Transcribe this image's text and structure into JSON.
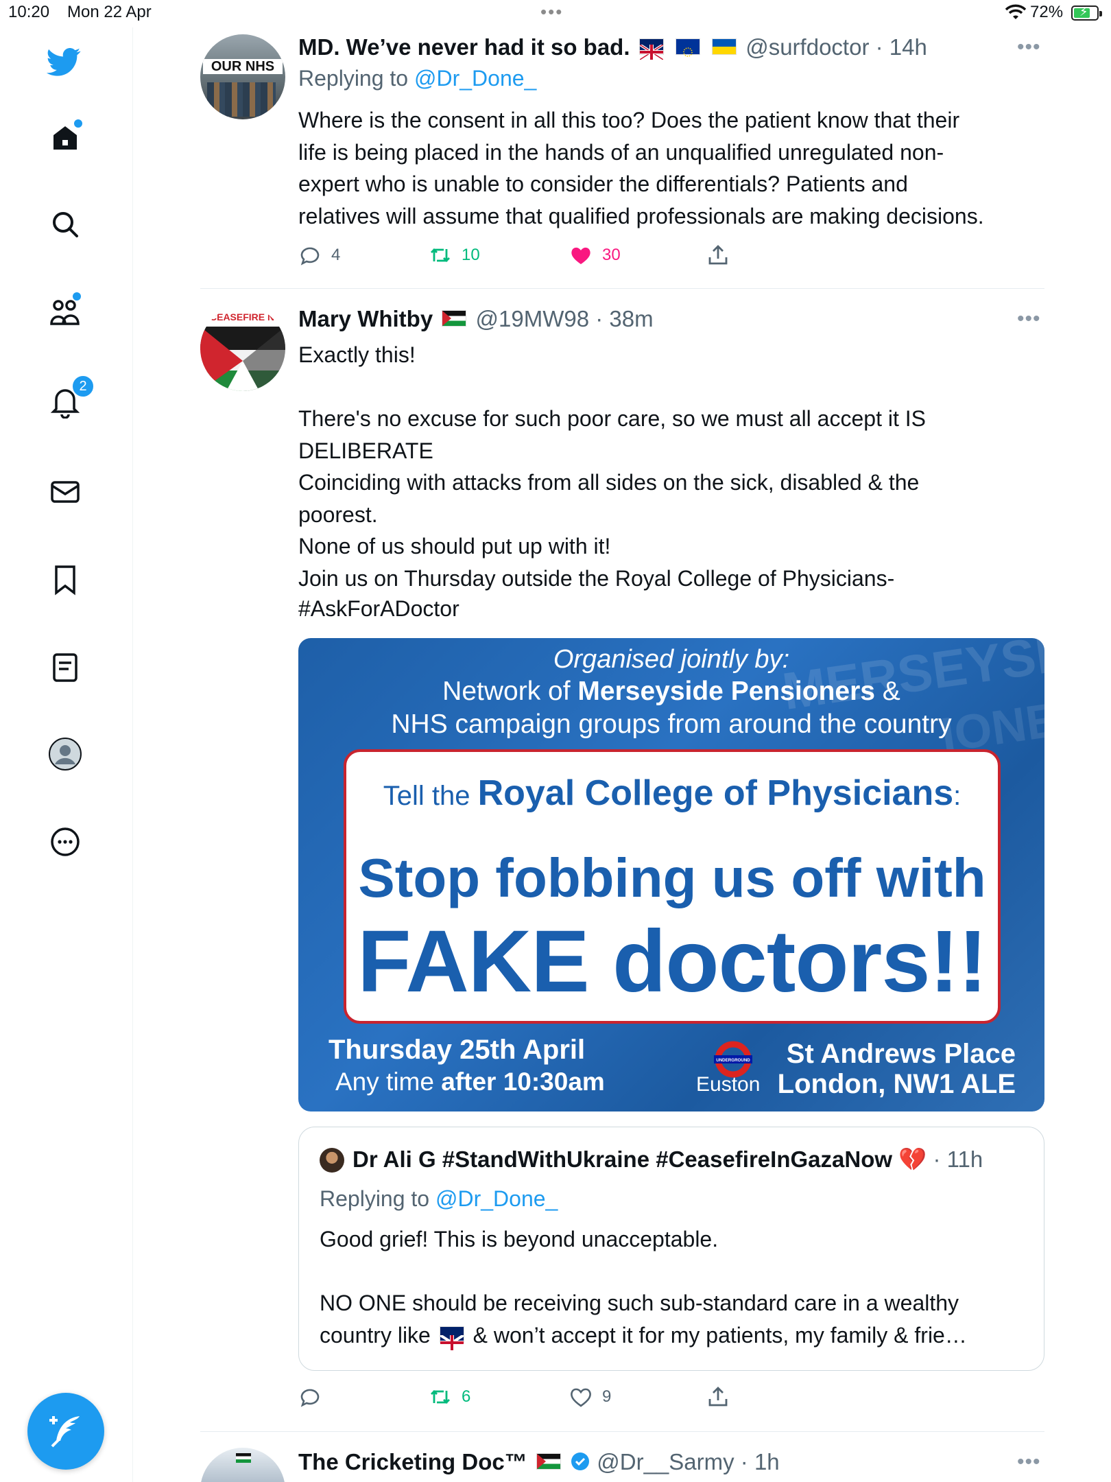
{
  "status_bar": {
    "time": "10:20",
    "date": "Mon 22 Apr",
    "battery_percent": "72%",
    "battery_level": 0.72
  },
  "sidebar": {
    "items": [
      "twitter-logo",
      "home",
      "search",
      "communities",
      "notifications",
      "messages",
      "bookmarks",
      "lists",
      "profile",
      "more"
    ],
    "notification_count": "2"
  },
  "tweets": [
    {
      "name": "MD. We’ve never had it so bad.",
      "flags": [
        "gb-flag",
        "eu-flag",
        "ukraine-flag"
      ],
      "handle": "@surfdoctor",
      "time": "· 14h",
      "avatar_text": "OUR NHS",
      "replying_prefix": "Replying to",
      "replying_to": "@Dr_Done_",
      "text": "Where is the consent in all this too? Does the patient know that their\nlife is being placed in the hands of an unqualified unregulated non-\nexpert who is unable to consider the differentials? Patients and\nrelatives will assume that qualified professionals are making decisions.",
      "replies": "4",
      "retweets": "10",
      "likes": "30",
      "liked": true
    },
    {
      "name": "Mary Whitby",
      "flags": [
        "palestine-flag"
      ],
      "handle": "@19MW98",
      "time": "· 38m",
      "avatar_text": "CEASEFIRE NO",
      "text": "Exactly this!\n\nThere's no excuse for such poor care, so we must all accept it IS\nDELIBERATE\nCoinciding with attacks from all sides on the sick, disabled & the\npoorest.\nNone of us should put up with it!\nJoin us on Thursday outside the Royal College of Physicians-",
      "hashtag": "#AskForADoctor",
      "poster": {
        "organised": "Organised jointly by:",
        "line1_pre": "Network of ",
        "line1_bold": "Merseyside Pensioners",
        "line1_post": " &",
        "line2": "NHS campaign groups from around the country",
        "tell_pre": "Tell the ",
        "tell_bold": "Royal College of Physicians",
        "tell_post": ":",
        "stop": "Stop fobbing us off with",
        "fake": "FAKE doctors!!",
        "date": "Thursday 25th April",
        "time_pre": "Any time ",
        "time_bold": "after 10:30am",
        "station": "Euston",
        "underground": "UNDERGROUND",
        "address1": "St Andrews Place",
        "address2": "London, NW1 ALE",
        "bg_text1": "MERSEYSI",
        "bg_text2": "IONE"
      },
      "quote": {
        "name": "Dr Ali G #StandWithUkraine #CeasefireInGazaNow",
        "emoji": "broken-heart",
        "time": "· 11h",
        "replying_prefix": "Replying to",
        "replying_to": "@Dr_Done_",
        "text_1": "Good grief! This is beyond unacceptable.\n\nNO ONE should be receiving such sub-standard care in a wealthy\ncountry like ",
        "text_2": " & won’t accept it for my patients, my family & frie…"
      },
      "replies": "",
      "retweets": "6",
      "likes": "9",
      "liked": false
    },
    {
      "name": "The Cricketing Doc™",
      "flags": [
        "palestine-flag"
      ],
      "verified": true,
      "handle": "@Dr__Sarmy",
      "time": "· 1h"
    }
  ],
  "colors": {
    "accent": "#1d9bf0",
    "like": "#f91880",
    "retweet": "#00ba7c",
    "muted": "#536471"
  }
}
